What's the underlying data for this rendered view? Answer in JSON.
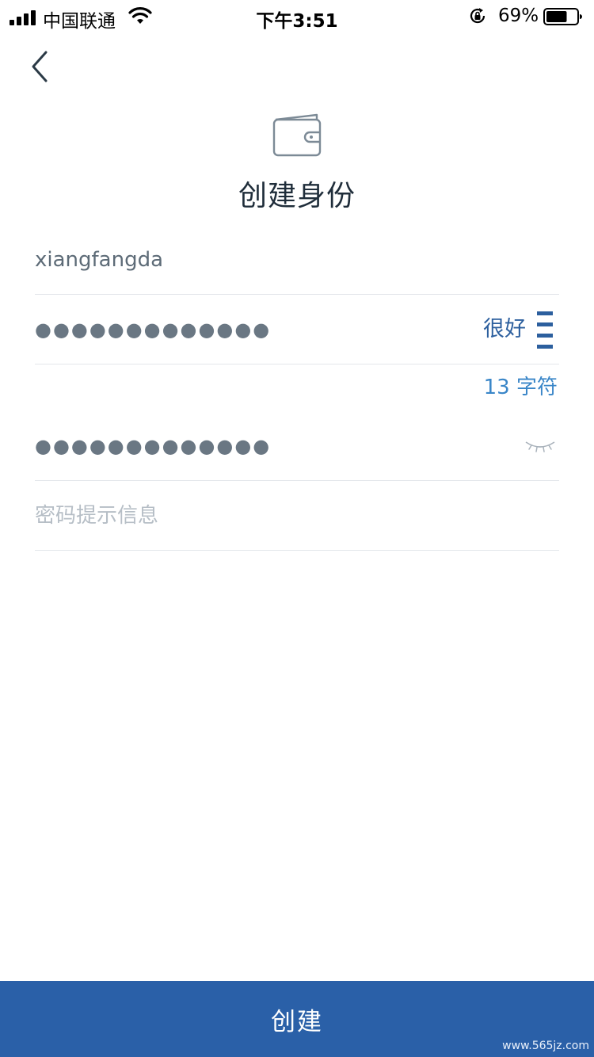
{
  "status_bar": {
    "carrier": "中国联通",
    "time": "下午3:51",
    "battery_percent": "69%",
    "battery_level": 0.69
  },
  "header": {
    "title": "创建身份",
    "icon": "wallet-icon"
  },
  "form": {
    "identity_name_value": "xiangfangda",
    "password_masked": "●●●●●●●●●●●●●",
    "password_strength": "很好",
    "password_char_count": "13 字符",
    "confirm_password_masked": "●●●●●●●●●●●●●",
    "hint_placeholder": "密码提示信息",
    "hint_value": ""
  },
  "actions": {
    "create_label": "创建"
  },
  "watermark": "www.565jz.com",
  "colors": {
    "primary": "#2a60a8",
    "strength": "#2c5f9e",
    "count": "#3a86c8",
    "divider": "#e3e6ea"
  }
}
